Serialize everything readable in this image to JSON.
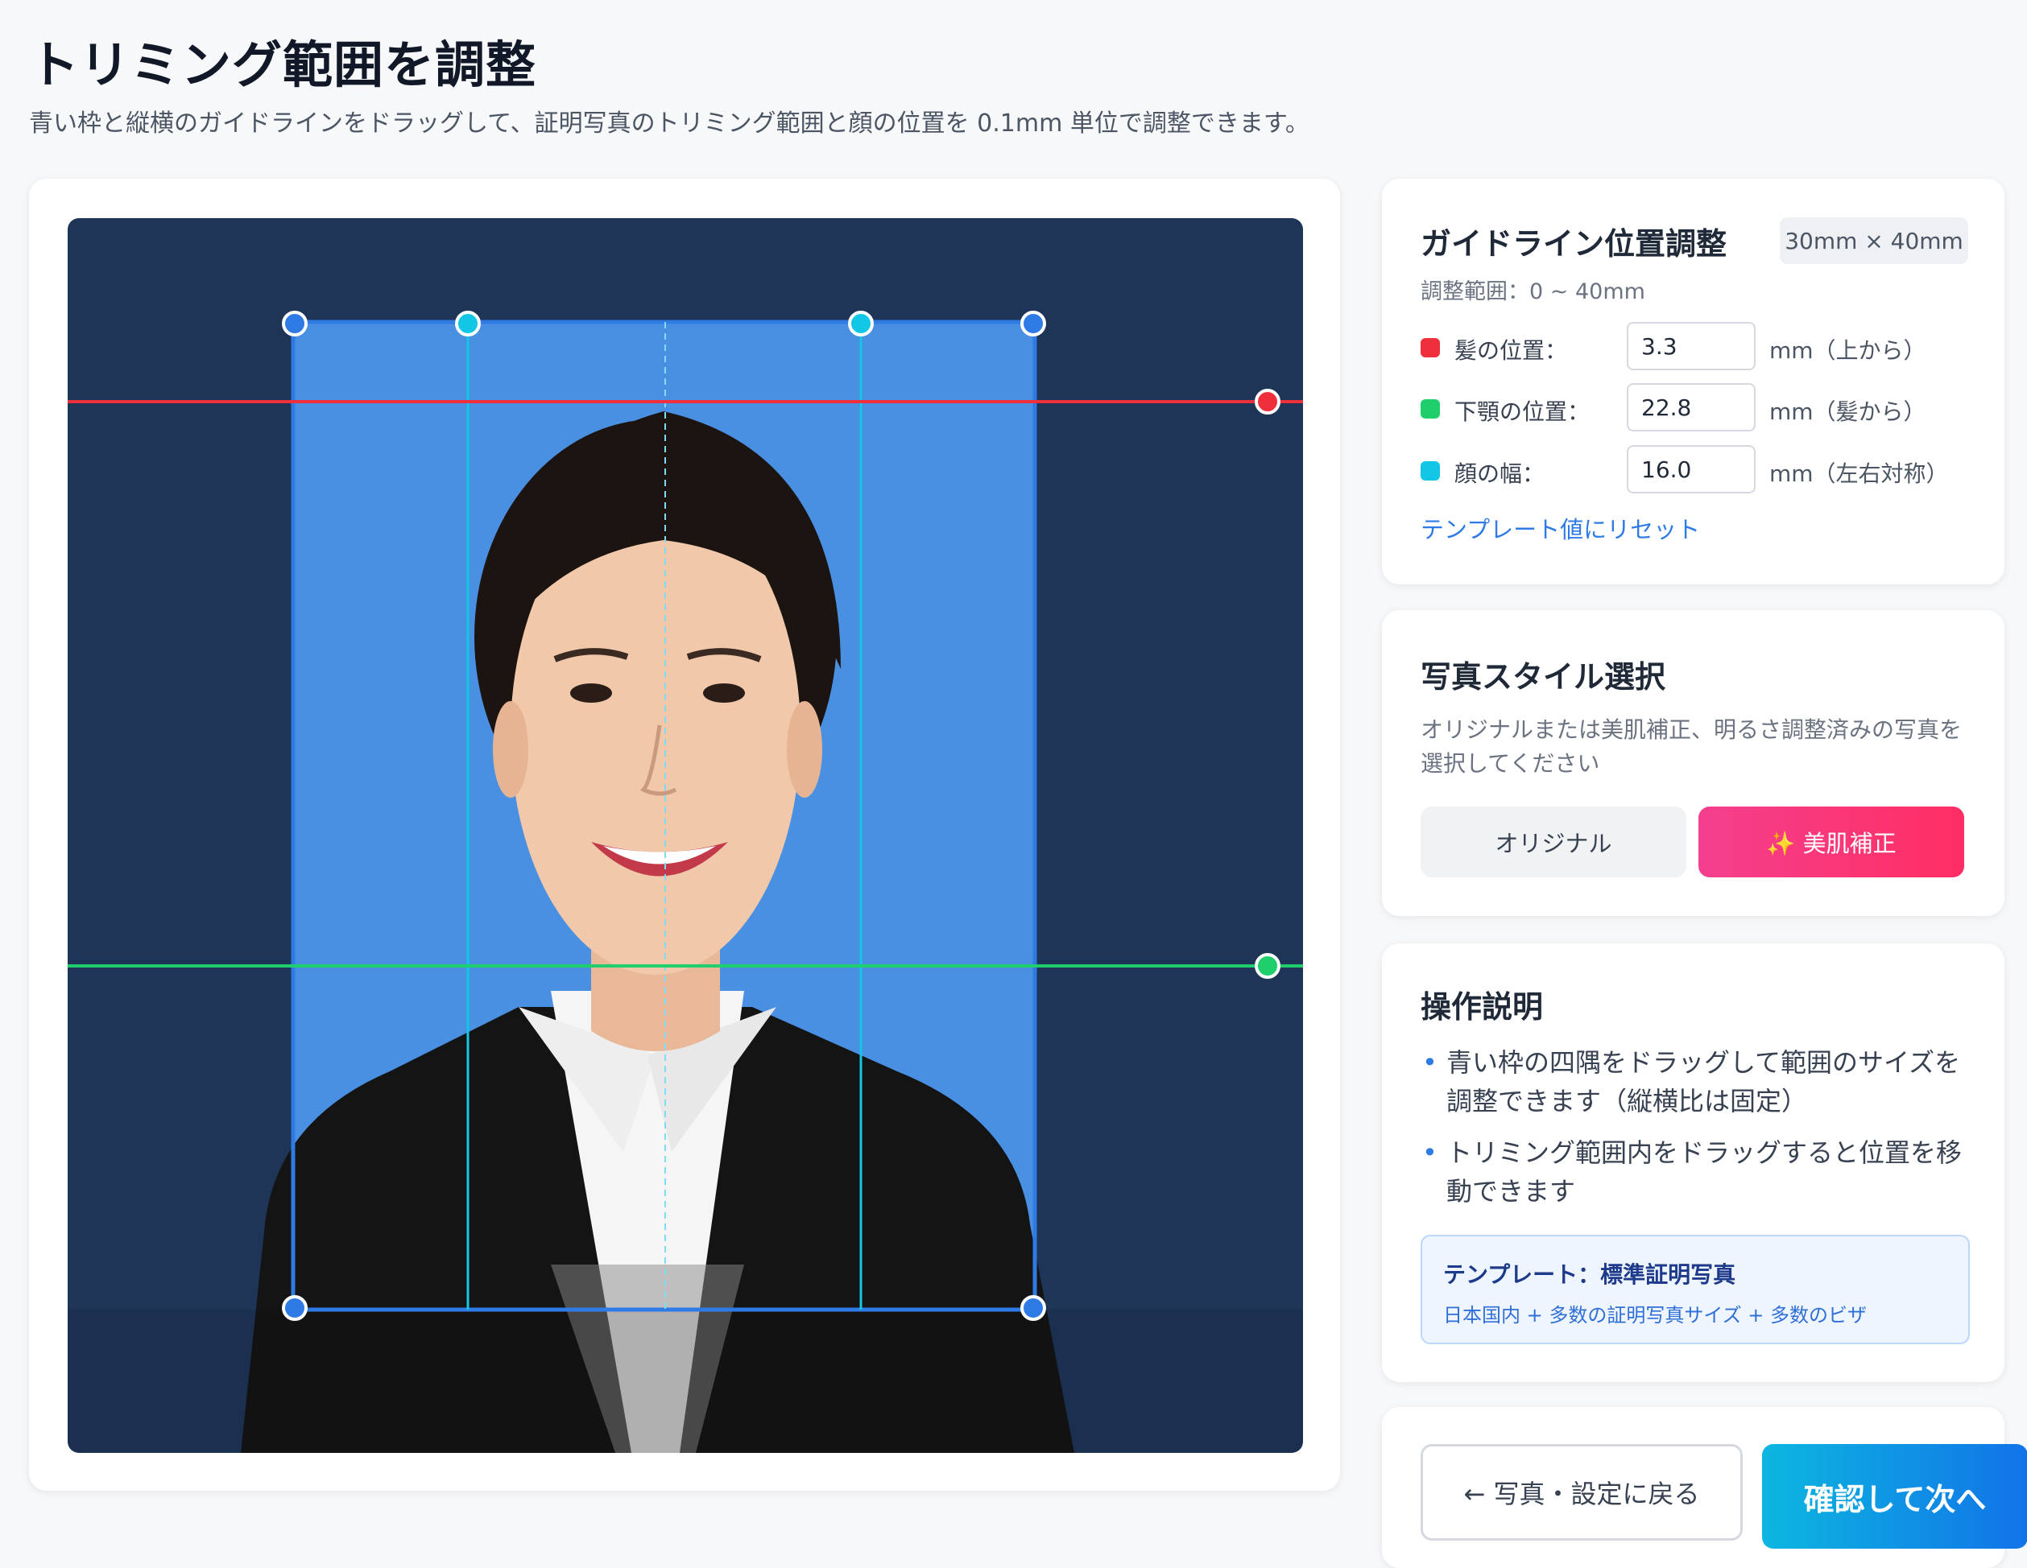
{
  "header": {
    "title": "トリミング範囲を調整",
    "subtitle": "青い枠と縦横のガイドラインをドラッグして、証明写真のトリミング範囲と顔の位置を 0.1mm 単位で調整できます。"
  },
  "guide_panel": {
    "title": "ガイドライン位置調整",
    "size_badge": "30mm × 40mm",
    "range_text": "調整範囲：0 ~ 40mm",
    "rows": [
      {
        "label": "髪の位置：",
        "value": "3.3",
        "unit": "mm（上から）",
        "color": "#ef2f3c"
      },
      {
        "label": "下顎の位置：",
        "value": "22.8",
        "unit": "mm（髪から）",
        "color": "#1fcf6c"
      },
      {
        "label": "顔の幅：",
        "value": "16.0",
        "unit": "mm（左右対称）",
        "color": "#12c6e6"
      }
    ],
    "reset_label": "テンプレート値にリセット"
  },
  "style_panel": {
    "title": "写真スタイル選択",
    "description": "オリジナルまたは美肌補正、明るさ調整済みの写真を選択してください",
    "original_label": "オリジナル",
    "beauty_label": "✨ 美肌補正"
  },
  "help_panel": {
    "title": "操作説明",
    "items": [
      "青い枠の四隅をドラッグして範囲のサイズを調整できます（縦横比は固定）",
      "トリミング範囲内をドラッグすると位置を移動できます"
    ],
    "template_title": "テンプレート：標準証明写真",
    "template_sub": "日本国内 + 多数の証明写真サイズ + 多数のビザ"
  },
  "actions": {
    "back_label": "← 写真・設定に戻る",
    "next_label": "確認して次へ"
  },
  "colors": {
    "canvas_bg": "#1e3557",
    "crop_fill": "#4a90e2",
    "crop_border": "#2f7be6",
    "hair_line": "#ef2f3c",
    "chin_line": "#1fcf6c",
    "face_width_line": "#12c6e6",
    "accent": "#2f7be6"
  }
}
